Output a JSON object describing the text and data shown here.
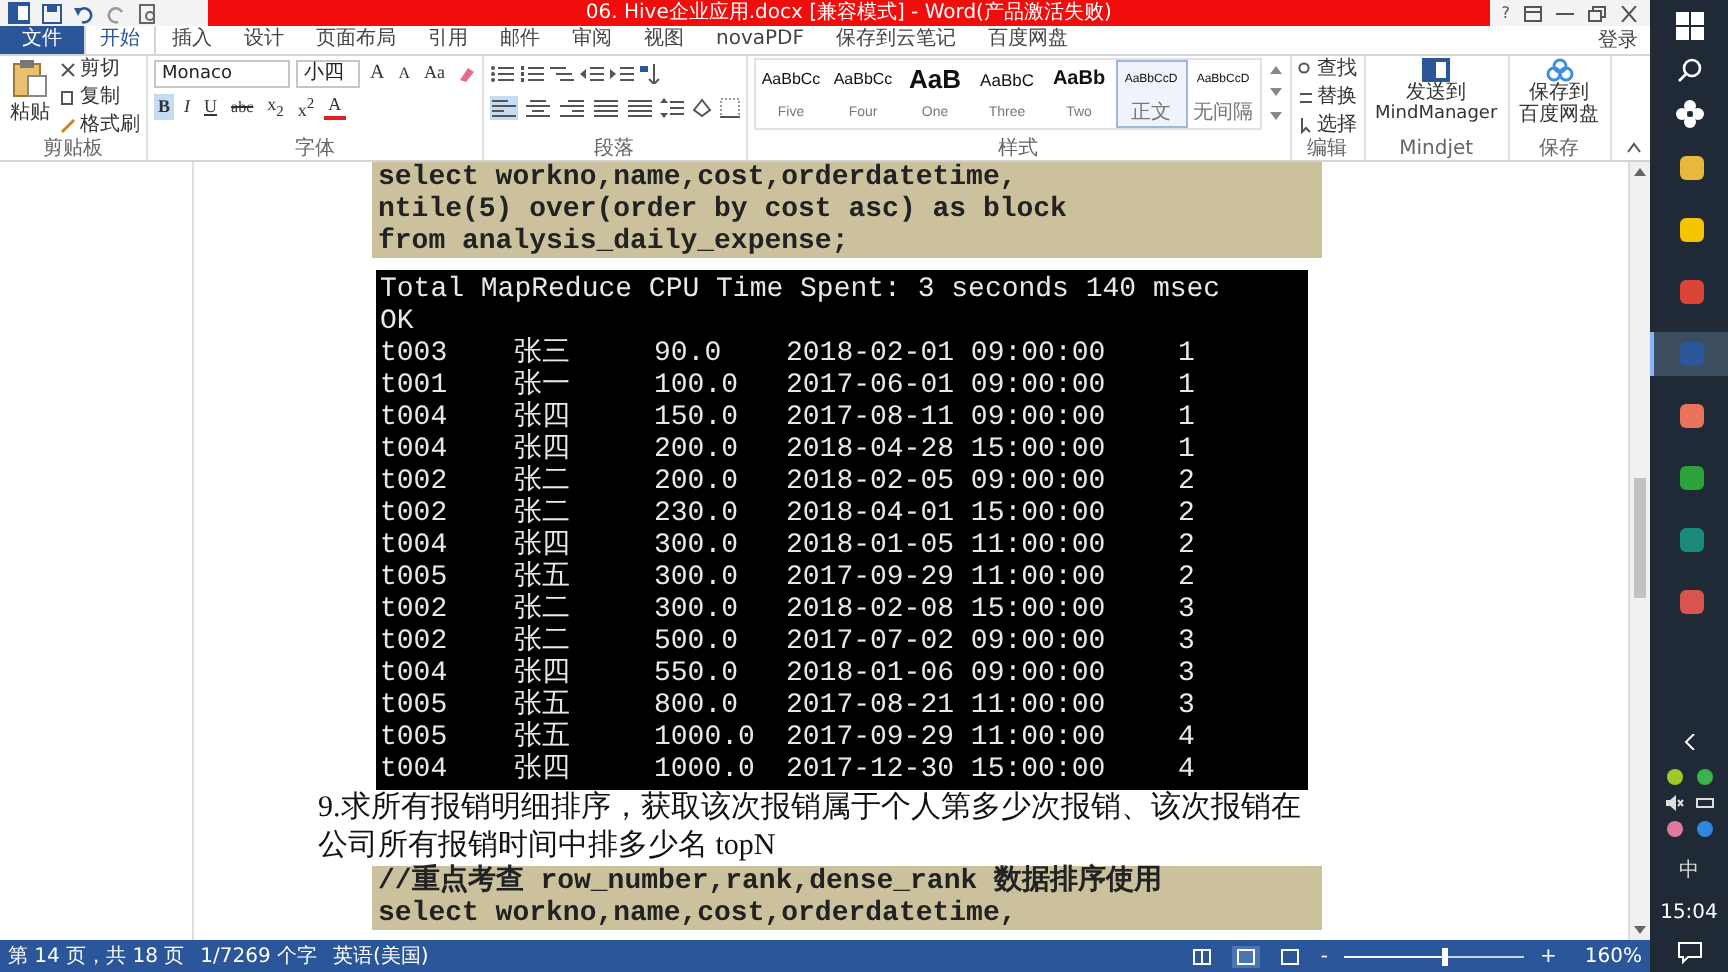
{
  "title_bar": {
    "title": "06. Hive企业应用.docx [兼容模式] - Word(产品激活失败)",
    "help": "?"
  },
  "tabs": [
    {
      "label": "文件",
      "selected": false,
      "kind": "file"
    },
    {
      "label": "开始",
      "selected": true,
      "kind": "tab"
    },
    {
      "label": "插入",
      "selected": false,
      "kind": "tab"
    },
    {
      "label": "设计",
      "selected": false,
      "kind": "tab"
    },
    {
      "label": "页面布局",
      "selected": false,
      "kind": "tab"
    },
    {
      "label": "引用",
      "selected": false,
      "kind": "tab"
    },
    {
      "label": "邮件",
      "selected": false,
      "kind": "tab"
    },
    {
      "label": "审阅",
      "selected": false,
      "kind": "tab"
    },
    {
      "label": "视图",
      "selected": false,
      "kind": "tab"
    },
    {
      "label": "novaPDF",
      "selected": false,
      "kind": "tab"
    },
    {
      "label": "保存到云笔记",
      "selected": false,
      "kind": "tab"
    },
    {
      "label": "百度网盘",
      "selected": false,
      "kind": "tab"
    }
  ],
  "sign_in": "登录",
  "clipboard": {
    "label": "剪贴板",
    "paste": "粘贴",
    "items": [
      "剪切",
      "复制",
      "格式刷"
    ]
  },
  "font": {
    "label": "字体",
    "font_name": "Monaco",
    "font_size": "小四",
    "grow": "A",
    "shrink": "A",
    "case": "Aa",
    "format_buttons": [
      {
        "label": "B",
        "on": true,
        "kind": "bold"
      },
      {
        "label": "I",
        "on": false,
        "kind": "italic"
      },
      {
        "label": "U",
        "on": false,
        "kind": "underline"
      },
      {
        "label": "abc",
        "on": false,
        "kind": "strike"
      },
      {
        "label": "x$_{2}$",
        "on": false,
        "kind": "plain"
      },
      {
        "label": "x$^{2}$",
        "on": false,
        "kind": "plain"
      }
    ],
    "font_color": "A"
  },
  "paragraph": {
    "label": "段落",
    "alignments": [
      {
        "selected": true
      },
      {
        "selected": false
      },
      {
        "selected": false
      },
      {
        "selected": false
      },
      {
        "selected": false
      }
    ]
  },
  "styles": {
    "label": "样式",
    "items": [
      {
        "preview": "AaBbCc",
        "name": "Five",
        "selected": false,
        "kind": "normal"
      },
      {
        "preview": "AaBbCc",
        "name": "Four",
        "selected": false,
        "kind": "normal"
      },
      {
        "preview": "AaB",
        "name": "One",
        "selected": false,
        "kind": "large"
      },
      {
        "preview": "AaBbC",
        "name": "Three",
        "selected": false,
        "kind": "medium"
      },
      {
        "preview": "AaBb",
        "name": "Two",
        "selected": false,
        "kind": "bold"
      },
      {
        "preview": "AaBbCcD",
        "name": "正文",
        "selected": true,
        "kind": "small"
      },
      {
        "preview": "AaBbCcD",
        "name": "无间隔",
        "selected": false,
        "kind": "small"
      }
    ]
  },
  "editing": {
    "label": "编辑",
    "items": [
      "查找",
      "替换",
      "选择"
    ]
  },
  "mindjet": {
    "label": "Mindjet",
    "button_lines": [
      "发送到",
      "MindManager"
    ]
  },
  "save": {
    "label": "保存",
    "button_lines": [
      "保存到",
      "百度网盘"
    ]
  },
  "document": {
    "code_block_1": [
      "select workno,name,cost,orderdatetime,",
      "ntile(5) over(order by cost asc) as block",
      "from analysis_daily_expense;"
    ],
    "terminal": {
      "header": [
        "Total MapReduce CPU Time Spent: 3 seconds 140 msec",
        "OK"
      ],
      "rows": [
        [
          "t003",
          "张三",
          "90.0",
          "2018-02-01 09:00:00",
          "1"
        ],
        [
          "t001",
          "张一",
          "100.0",
          "2017-06-01 09:00:00",
          "1"
        ],
        [
          "t004",
          "张四",
          "150.0",
          "2017-08-11 09:00:00",
          "1"
        ],
        [
          "t004",
          "张四",
          "200.0",
          "2018-04-28 15:00:00",
          "1"
        ],
        [
          "t002",
          "张二",
          "200.0",
          "2018-02-05 09:00:00",
          "2"
        ],
        [
          "t002",
          "张二",
          "230.0",
          "2018-04-01 15:00:00",
          "2"
        ],
        [
          "t004",
          "张四",
          "300.0",
          "2018-01-05 11:00:00",
          "2"
        ],
        [
          "t005",
          "张五",
          "300.0",
          "2017-09-29 11:00:00",
          "2"
        ],
        [
          "t002",
          "张二",
          "300.0",
          "2018-02-08 15:00:00",
          "3"
        ],
        [
          "t002",
          "张二",
          "500.0",
          "2017-07-02 09:00:00",
          "3"
        ],
        [
          "t004",
          "张四",
          "550.0",
          "2018-01-06 09:00:00",
          "3"
        ],
        [
          "t005",
          "张五",
          "800.0",
          "2017-08-21 11:00:00",
          "3"
        ],
        [
          "t005",
          "张五",
          "1000.0",
          "2017-09-29 11:00:00",
          "4"
        ],
        [
          "t004",
          "张四",
          "1000.0",
          "2017-12-30 15:00:00",
          "4"
        ]
      ]
    },
    "heading": "9.求所有报销明细排序，获取该次报销属于个人第多少次报销、该次报销在公司所有报销时间中排多少名 topN",
    "code_block_2": [
      "//重点考查 row_number,rank,dense_rank 数据排序使用",
      "select workno,name,cost,orderdatetime,"
    ]
  },
  "status_bar": {
    "page": "第 14 页，共 18 页",
    "words": "1/7269 个字",
    "language": "英语(美国)",
    "views": [
      {
        "selected": false
      },
      {
        "selected": true
      },
      {
        "selected": false
      }
    ],
    "zoom": {
      "minus": "-",
      "plus": "+",
      "level": 0.55,
      "reading": "160%"
    }
  },
  "taskbar": {
    "apps": [
      {
        "kind": "folder",
        "selected": false
      },
      {
        "kind": "note",
        "selected": false
      },
      {
        "kind": "browser",
        "selected": false
      },
      {
        "kind": "word",
        "selected": true
      },
      {
        "kind": "red",
        "selected": false
      },
      {
        "kind": "green",
        "selected": false
      },
      {
        "kind": "teal",
        "selected": false
      },
      {
        "kind": "swirl",
        "selected": false
      }
    ],
    "ime": "中",
    "time": "15:04"
  }
}
